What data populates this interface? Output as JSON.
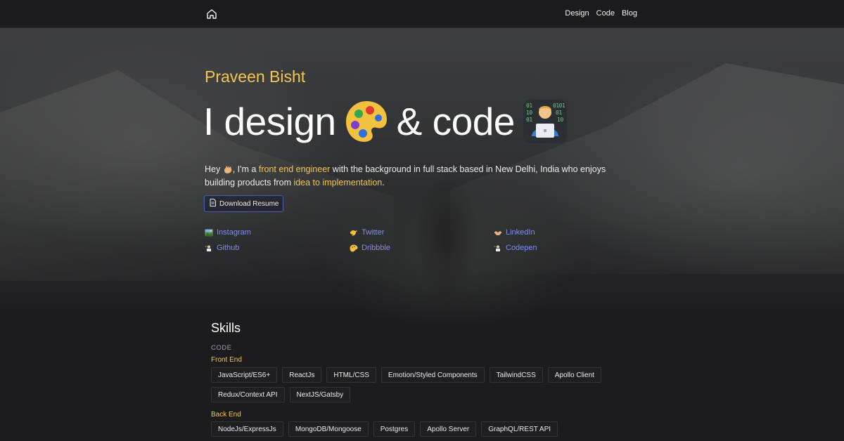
{
  "nav": {
    "home_icon": "home-icon",
    "links": [
      "Design",
      "Code",
      "Blog"
    ]
  },
  "hero": {
    "name": "Praveen Bisht",
    "headline_part1": "I design",
    "headline_part2": "& code",
    "intro": {
      "hey": "Hey",
      "after_wave": ", I'm a ",
      "role": "front end engineer",
      "middle": " with the background in full stack based in New Delhi, India who enjoys building products from ",
      "highlight": "idea to implementation",
      "end": "."
    },
    "resume_label": "Download Resume"
  },
  "socials": [
    {
      "label": "Instagram",
      "icon": "image-icon"
    },
    {
      "label": "Twitter",
      "icon": "bird-icon"
    },
    {
      "label": "LinkedIn",
      "icon": "handshake-icon"
    },
    {
      "label": "Github",
      "icon": "technologist-icon"
    },
    {
      "label": "Dribbble",
      "icon": "ball-icon"
    },
    {
      "label": "Codepen",
      "icon": "technologist-icon"
    }
  ],
  "skills": {
    "title": "Skills",
    "category": "CODE",
    "front_end_label": "Front End",
    "front_end_row1": [
      "JavaScript/ES6+",
      "ReactJs",
      "HTML/CSS",
      "Emotion/Styled Components",
      "TailwindCSS",
      "Apollo Client"
    ],
    "front_end_row2": [
      "Redux/Context API",
      "NextJS/Gatsby"
    ],
    "back_end_label": "Back End",
    "back_end_row1": [
      "NodeJs/ExpressJs",
      "MongoDB/Mongoose",
      "Postgres",
      "Apollo Server",
      "GraphQL/REST API"
    ]
  },
  "colors": {
    "accent_yellow": "#f5c451",
    "link_blue": "#7f8df0",
    "button_border": "#4b5cc4"
  }
}
